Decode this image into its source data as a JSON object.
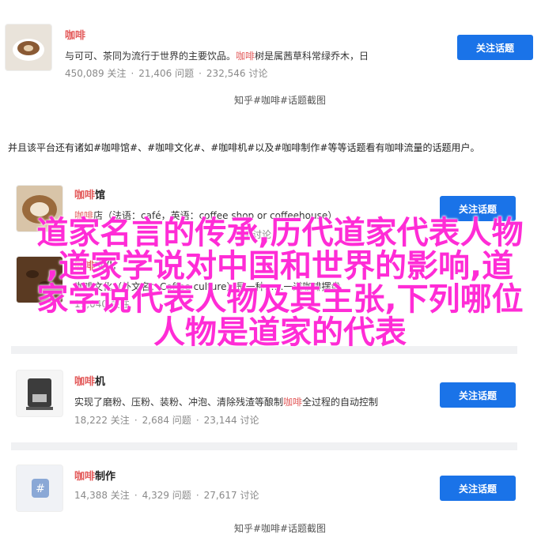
{
  "screenshot1": {
    "topic": {
      "title": "咖啡",
      "desc_before": "与可可、茶同为流行于世界的主要饮品。",
      "desc_hl": "咖啡",
      "desc_after": "树是属茜草科常绿乔木，日",
      "followers": "450,089 关注",
      "questions": "21,406 问题",
      "discussions": "232,546 讨论",
      "button": "关注话题"
    },
    "caption": "知乎#咖啡#话题截图"
  },
  "paragraph": "并且该平台还有诸如#咖啡馆#、#咖啡文化#、#咖啡机#以及#咖啡制作#等等话题看有咖啡流量的话题用户。",
  "screenshot2": {
    "topics": [
      {
        "title_hl": "咖啡",
        "title_rest": "馆",
        "desc_hl": "咖啡",
        "desc_rest": "店（法语：café，英语：coffee shop or coffeehouse）",
        "followers": "",
        "questions": "",
        "discussions": "74 讨论",
        "button": "关注话题"
      },
      {
        "title_hl": "咖啡",
        "title_rest": "文化",
        "desc_hl": "",
        "desc_rest": "咖啡文化（外文名：Coffee culture）是一种……一道咖啡摆盘",
        "followers": "19,040 关注",
        "questions": "",
        "discussions": "",
        "button": ""
      },
      {
        "title_hl": "咖啡",
        "title_rest": "机",
        "desc_hl": "咖啡",
        "desc_before": "实现了磨粉、压粉、装粉、冲泡、清除残渣等酿制",
        "desc_rest": "全过程的自动控制",
        "followers": "18,222 关注",
        "questions": "2,684 问题",
        "discussions": "23,144 讨论",
        "button": "关注话题"
      },
      {
        "title_hl": "咖啡",
        "title_rest": "制作",
        "followers": "14,388 关注",
        "questions": "4,329 问题",
        "discussions": "27,617 讨论",
        "button": "关注话题"
      }
    ],
    "caption": "知乎#咖啡#话题截图"
  },
  "overlay_lines": [
    "道家名言的传承,历代道家代表人物",
    ",道家学说对中国和世界的影响,道",
    "家学说代表人物及其主张,下列哪位",
    "人物是道家的代表"
  ],
  "colors": {
    "accent": "#1a73e8",
    "highlight": "#e35b5b",
    "overlay": "#ff2cd6"
  }
}
